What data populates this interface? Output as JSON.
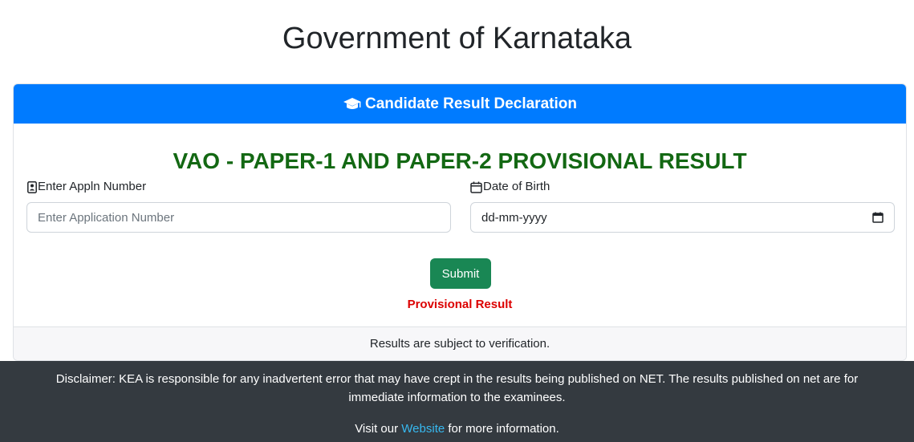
{
  "header": {
    "title": "Government of Karnataka"
  },
  "card": {
    "header_title": "Candidate Result Declaration",
    "result_title": "VAO - PAPER-1 AND PAPER-2 PROVISIONAL RESULT",
    "appln_field": {
      "label": "Enter Appln Number",
      "placeholder": "Enter Application Number",
      "icon": "id-card-icon"
    },
    "dob_field": {
      "label": "Date of Birth",
      "value": "dd-mm-yyyy",
      "icon": "calendar-icon"
    },
    "submit_label": "Submit",
    "provisional_label": "Provisional Result",
    "footer_text": "Results are subject to verification."
  },
  "disclaimer": {
    "text": "Disclaimer: KEA is responsible for any inadvertent error that may have crept in the results being published on NET. The results published on net are for immediate information to the examinees.",
    "visit_prefix": "Visit our",
    "link_text": "Website",
    "visit_suffix": "for more information."
  },
  "colors": {
    "primary": "#007bff",
    "success": "#198754",
    "result_title": "#136813",
    "provisional": "#dc0000",
    "link": "#37b9f0",
    "footer_bg": "#343a40"
  }
}
